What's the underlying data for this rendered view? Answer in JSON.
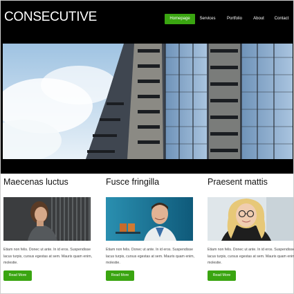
{
  "site": {
    "logo": "CONSECUTIVE"
  },
  "nav": {
    "items": [
      {
        "label": "Homepage",
        "active": true
      },
      {
        "label": "Services",
        "active": false
      },
      {
        "label": "Portfolio",
        "active": false
      },
      {
        "label": "About",
        "active": false
      },
      {
        "label": "Contact",
        "active": false
      }
    ]
  },
  "hero": {
    "image": "building-photo"
  },
  "columns": [
    {
      "title": "Maecenas luctus",
      "image": "woman-at-desk-photo",
      "text": "Etiam non felis. Donec ut ante. In id eros. Suspendisse lacus turpis, cursus egestas at sem. Mauris quam enim, molestie.",
      "button": "Read More"
    },
    {
      "title": "Fusce fringilla",
      "image": "smiling-man-photo",
      "text": "Etiam non felis. Donec ut ante. In id eros. Suspendisse lacus turpis, cursus egestas at sem. Mauris quam enim, molestie.",
      "button": "Read More"
    },
    {
      "title": "Praesent mattis",
      "image": "blonde-woman-photo",
      "text": "Etiam non felis. Donec ut ante. In id eros. Suspendisse lacus turpis, cursus egestas at sem. Mauris quam enim, molestie.",
      "button": "Read More"
    }
  ],
  "colors": {
    "accent": "#3aa511",
    "header_bg": "#000000",
    "text": "#111111"
  }
}
